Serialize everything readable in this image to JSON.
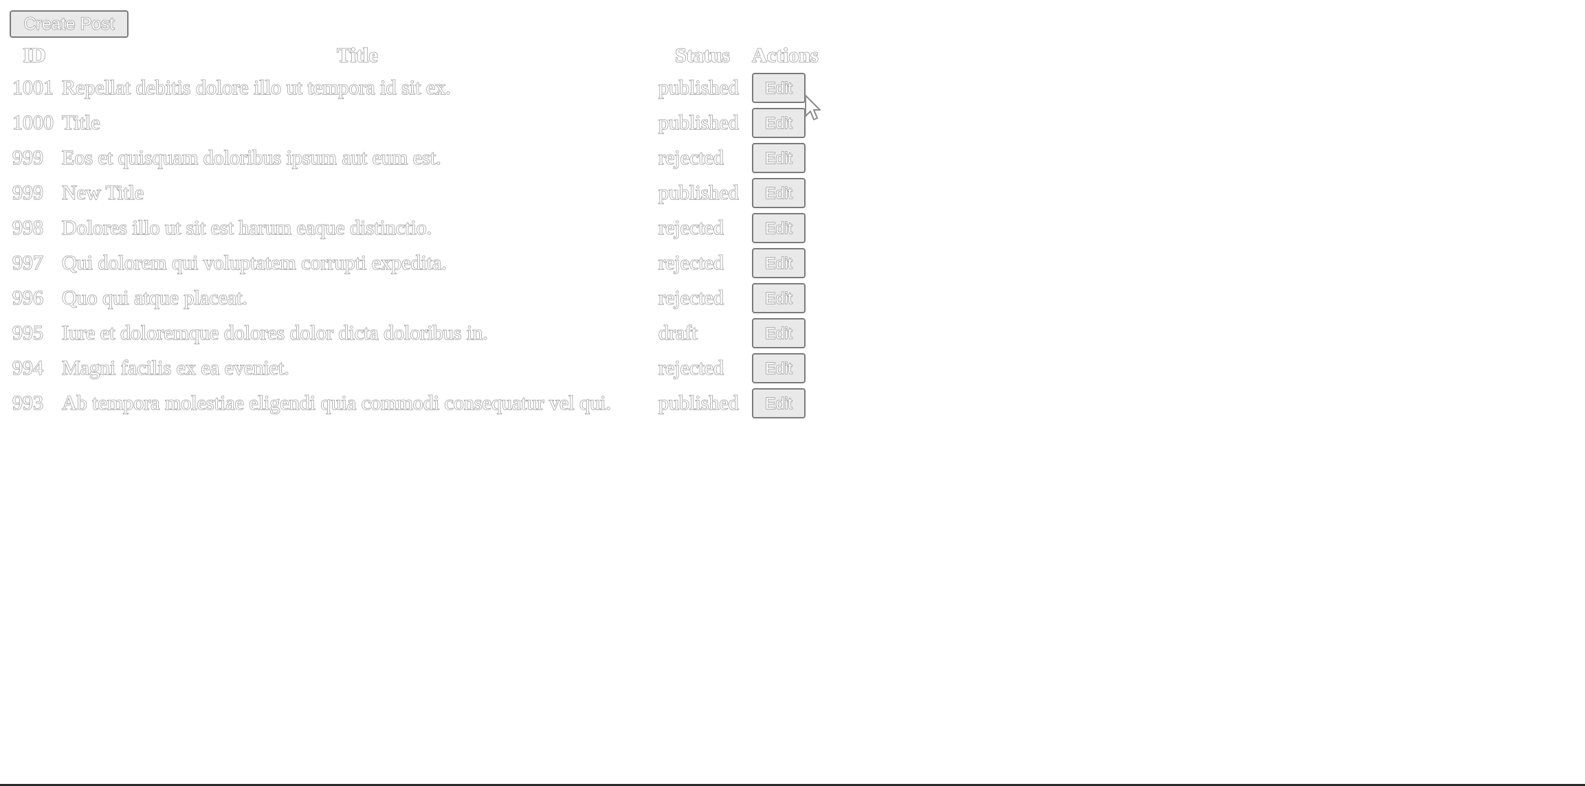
{
  "toolbar": {
    "create_label": "Create Post"
  },
  "table": {
    "headers": {
      "id": "ID",
      "title": "Title",
      "status": "Status",
      "actions": "Actions"
    },
    "rows": [
      {
        "id": "1001",
        "title": "Repellat debitis dolore illo ut tempora id sit ex.",
        "status": "published",
        "action": "Edit"
      },
      {
        "id": "1000",
        "title": "Title",
        "status": "published",
        "action": "Edit"
      },
      {
        "id": "999",
        "title": "Eos et quisquam doloribus ipsum aut eum est.",
        "status": "rejected",
        "action": "Edit"
      },
      {
        "id": "999",
        "title": "New Title",
        "status": "published",
        "action": "Edit"
      },
      {
        "id": "998",
        "title": "Dolores illo ut sit est harum eaque distinctio.",
        "status": "rejected",
        "action": "Edit"
      },
      {
        "id": "997",
        "title": "Qui dolorem qui voluptatem corrupti expedita.",
        "status": "rejected",
        "action": "Edit"
      },
      {
        "id": "996",
        "title": "Quo qui atque placeat.",
        "status": "rejected",
        "action": "Edit"
      },
      {
        "id": "995",
        "title": "Iure et doloremque dolores dolor dicta doloribus in.",
        "status": "draft",
        "action": "Edit"
      },
      {
        "id": "994",
        "title": "Magni facilis ex ea eveniet.",
        "status": "rejected",
        "action": "Edit"
      },
      {
        "id": "993",
        "title": "Ab tempora molestiae eligendi quia commodi consequatur vel qui.",
        "status": "published",
        "action": "Edit"
      }
    ]
  },
  "icons": {
    "cursor": "mouse-pointer-icon"
  }
}
